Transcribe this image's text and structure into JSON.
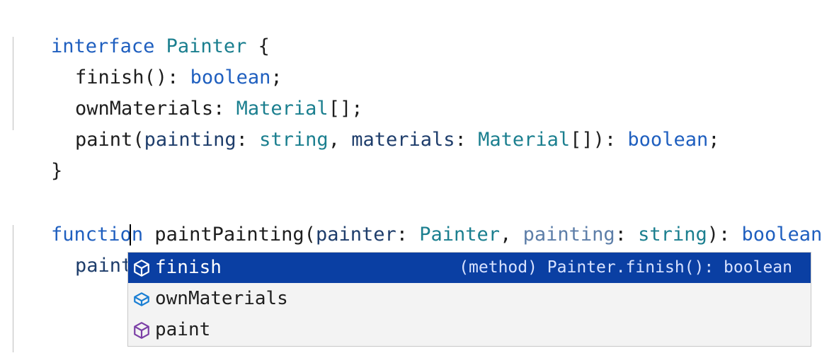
{
  "editor": {
    "lines": {
      "l1": {
        "kw": "interface",
        "name": "Painter",
        "brace": "{"
      },
      "l2": {
        "name": "finish",
        "punc1": "():",
        "type": "boolean",
        "end": ";"
      },
      "l3": {
        "name": "ownMaterials",
        "punc1": ":",
        "type": "Material",
        "end": "[];"
      },
      "l4": {
        "name": "paint",
        "open": "(",
        "p1": "painting",
        "c1": ":",
        "t1": "string",
        "sep": ",",
        "p2": "materials",
        "c2": ":",
        "t2": "Material",
        "close": "[]):",
        "ret": "boolean",
        "end": ";"
      },
      "l5": {
        "brace": "}"
      },
      "l7": {
        "kw": "function",
        "name": "paintPainting",
        "open": "(",
        "p1": "painter",
        "c1": ":",
        "t1": "Painter",
        "sep": ",",
        "p2": "painting",
        "c2": ":",
        "t2": "string",
        "close": "):",
        "ret": "boolean"
      },
      "l8": {
        "text": "painter."
      }
    }
  },
  "suggest": {
    "items": [
      {
        "label": "finish",
        "detail": "(method) Painter.finish(): boolean",
        "icon": "method-cube-icon"
      },
      {
        "label": "ownMaterials",
        "detail": "",
        "icon": "property-cube-icon"
      },
      {
        "label": "paint",
        "detail": "",
        "icon": "method-cube-icon"
      }
    ]
  },
  "colors": {
    "keyword": "#1f5fbf",
    "type": "#1b7f8f",
    "selection": "#0a3fa3",
    "method_icon": "#7b3fa6",
    "property_icon": "#1a7fd4"
  }
}
